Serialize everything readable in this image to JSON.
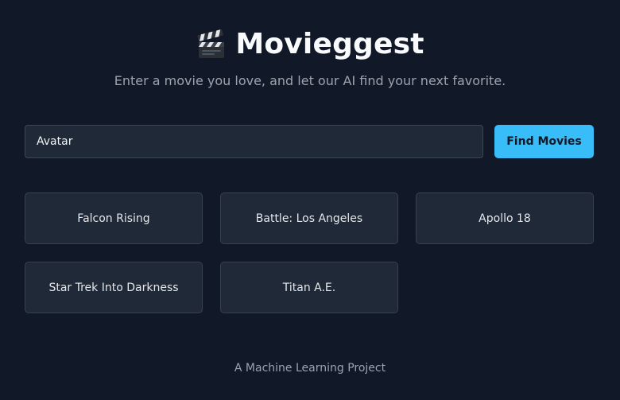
{
  "header": {
    "title": "Movieggest",
    "icon": "clapperboard-icon",
    "subtitle": "Enter a movie you love, and let our AI find your next favorite."
  },
  "search": {
    "value": "Avatar",
    "button_label": "Find Movies"
  },
  "results": [
    {
      "title": "Falcon Rising"
    },
    {
      "title": "Battle: Los Angeles"
    },
    {
      "title": "Apollo 18"
    },
    {
      "title": "Star Trek Into Darkness"
    },
    {
      "title": "Titan A.E."
    }
  ],
  "footer": {
    "text": "A Machine Learning Project"
  },
  "colors": {
    "background": "#111827",
    "surface": "#1f2937",
    "border": "#374151",
    "accent": "#38bdf8",
    "muted_text": "#9ca3af"
  }
}
